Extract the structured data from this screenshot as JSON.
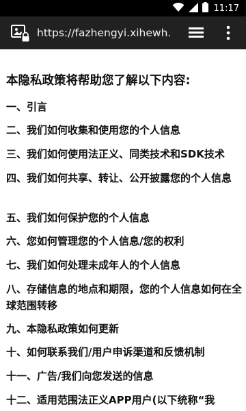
{
  "status_bar": {
    "time": "11:17",
    "icons": [
      "wifi-icon",
      "signal-icon",
      "battery-icon"
    ]
  },
  "browser": {
    "url": "https://fazhengyi.xihewh.",
    "icons": [
      "site-security-icon",
      "tabs-icon",
      "overflow-menu-icon"
    ]
  },
  "page": {
    "heading": "本隐私政策将帮助您了解以下内容:",
    "toc": [
      "一、引言",
      "二、我们如何收集和使用您的个人信息",
      "三、我们如何使用法正义、同类技术和SDK技术",
      "四、我们如何共享、转让、公开披露您的个人信息",
      "五、我们如何保护您的个人信息",
      "六、您如何管理您的个人信息/您的权利",
      "七、我们如何处理未成年人的个人信息",
      "八、存储信息的地点和期限，您的个人信息如何在全球范围转移",
      "九、本隐私政策如何更新",
      "十、如何联系我们/用户申诉渠道和反馈机制",
      "十一、广告/我们向您发送的信息",
      "十二、适用范围法正义APP用户(以下统称“我"
    ]
  },
  "colors": {
    "status_bar_bg": "#000000",
    "toolbar_bg": "#212121",
    "page_bg": "#ffffff",
    "text": "#111111"
  }
}
